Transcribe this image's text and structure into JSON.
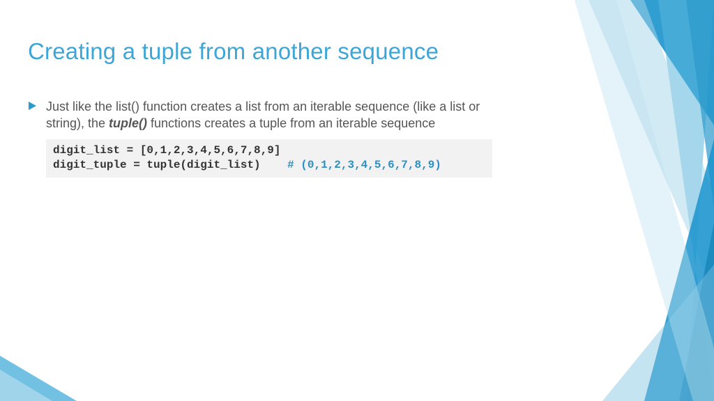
{
  "title": "Creating a tuple from another sequence",
  "bullet": {
    "pre": "Just like the list() function creates a list from an iterable sequence (like a list or string), the ",
    "emph": "tuple()",
    "post": " functions creates a tuple from an iterable sequence"
  },
  "code": {
    "line1": "digit_list = [0,1,2,3,4,5,6,7,8,9]",
    "line2_code": "digit_tuple = tuple(digit_list)    ",
    "line2_comment": "# (0,1,2,3,4,5,6,7,8,9)"
  }
}
